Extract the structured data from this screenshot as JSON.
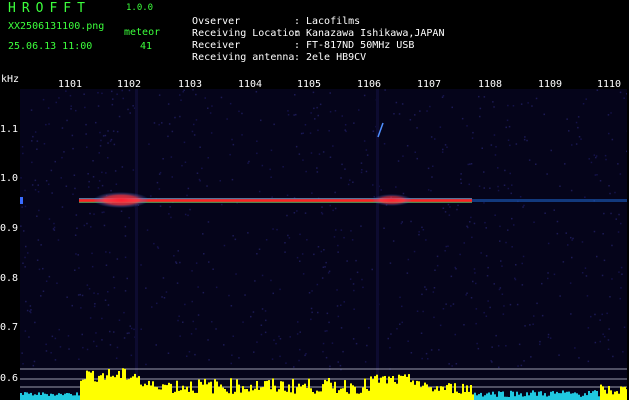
{
  "app": {
    "name": "HROFFT",
    "version": "1.0.0"
  },
  "file": {
    "filename": "XX2506131100.png",
    "timestamp": "25.06.13 11:00",
    "count_label": "meteor",
    "count_value": "41"
  },
  "station": [
    {
      "label": "Ovserver",
      "value": "Lacofilms"
    },
    {
      "label": "Receiving Location",
      "value": "Kanazawa Ishikawa,JAPAN"
    },
    {
      "label": "Receiver",
      "value": "FT-817ND 50MHz USB"
    },
    {
      "label": "Receiving antenna",
      "value": "2ele HB9CV"
    }
  ],
  "axes": {
    "y_unit": "kHz",
    "x_ticks": [
      "1101",
      "1102",
      "1103",
      "1104",
      "1105",
      "1106",
      "1107",
      "1108",
      "1109",
      "1110"
    ],
    "y_ticks": [
      "1.1",
      "1.0",
      "0.9",
      "0.8",
      "0.7",
      "0.6"
    ]
  },
  "colors": {
    "background": "#000000",
    "waterfall_bg": "#05041a",
    "trace": "#ff2020",
    "echo_bar": "#ffff00",
    "title_green": "#3cff3c",
    "tick_text": "#ffffff"
  }
}
